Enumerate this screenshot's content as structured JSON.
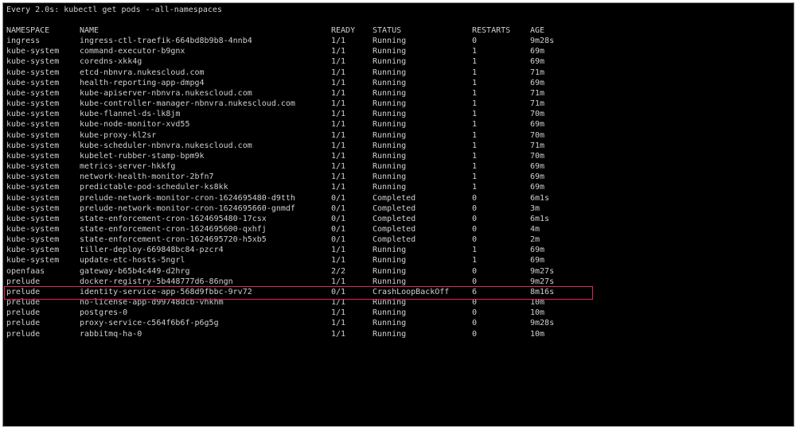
{
  "terminal": {
    "header": "Every 2.0s: kubectl get pods --all-namespaces"
  },
  "columns": {
    "namespace": "NAMESPACE",
    "name": "NAME",
    "ready": "READY",
    "status": "STATUS",
    "restarts": "RESTARTS",
    "age": "AGE"
  },
  "pods": [
    {
      "namespace": "ingress",
      "name": "ingress-ctl-traefik-664bd8b9b8-4nnb4",
      "ready": "1/1",
      "status": "Running",
      "restarts": "0",
      "age": "9m28s"
    },
    {
      "namespace": "kube-system",
      "name": "command-executor-b9gnx",
      "ready": "1/1",
      "status": "Running",
      "restarts": "1",
      "age": "69m"
    },
    {
      "namespace": "kube-system",
      "name": "coredns-xkk4g",
      "ready": "1/1",
      "status": "Running",
      "restarts": "1",
      "age": "69m"
    },
    {
      "namespace": "kube-system",
      "name": "etcd-nbnvra.nukescloud.com",
      "ready": "1/1",
      "status": "Running",
      "restarts": "1",
      "age": "71m"
    },
    {
      "namespace": "kube-system",
      "name": "health-reporting-app-dmpg4",
      "ready": "1/1",
      "status": "Running",
      "restarts": "1",
      "age": "69m"
    },
    {
      "namespace": "kube-system",
      "name": "kube-apiserver-nbnvra.nukescloud.com",
      "ready": "1/1",
      "status": "Running",
      "restarts": "1",
      "age": "71m"
    },
    {
      "namespace": "kube-system",
      "name": "kube-controller-manager-nbnvra.nukescloud.com",
      "ready": "1/1",
      "status": "Running",
      "restarts": "1",
      "age": "71m"
    },
    {
      "namespace": "kube-system",
      "name": "kube-flannel-ds-lk8jm",
      "ready": "1/1",
      "status": "Running",
      "restarts": "1",
      "age": "70m"
    },
    {
      "namespace": "kube-system",
      "name": "kube-node-monitor-xvd55",
      "ready": "1/1",
      "status": "Running",
      "restarts": "1",
      "age": "69m"
    },
    {
      "namespace": "kube-system",
      "name": "kube-proxy-kl2sr",
      "ready": "1/1",
      "status": "Running",
      "restarts": "1",
      "age": "70m"
    },
    {
      "namespace": "kube-system",
      "name": "kube-scheduler-nbnvra.nukescloud.com",
      "ready": "1/1",
      "status": "Running",
      "restarts": "1",
      "age": "71m"
    },
    {
      "namespace": "kube-system",
      "name": "kubelet-rubber-stamp-bpm9k",
      "ready": "1/1",
      "status": "Running",
      "restarts": "1",
      "age": "70m"
    },
    {
      "namespace": "kube-system",
      "name": "metrics-server-hkkfg",
      "ready": "1/1",
      "status": "Running",
      "restarts": "1",
      "age": "69m"
    },
    {
      "namespace": "kube-system",
      "name": "network-health-monitor-2bfn7",
      "ready": "1/1",
      "status": "Running",
      "restarts": "1",
      "age": "69m"
    },
    {
      "namespace": "kube-system",
      "name": "predictable-pod-scheduler-ks8kk",
      "ready": "1/1",
      "status": "Running",
      "restarts": "1",
      "age": "69m"
    },
    {
      "namespace": "kube-system",
      "name": "prelude-network-monitor-cron-1624695480-d9tth",
      "ready": "0/1",
      "status": "Completed",
      "restarts": "0",
      "age": "6m1s"
    },
    {
      "namespace": "kube-system",
      "name": "prelude-network-monitor-cron-1624695660-gnmdf",
      "ready": "0/1",
      "status": "Completed",
      "restarts": "0",
      "age": "3m"
    },
    {
      "namespace": "kube-system",
      "name": "state-enforcement-cron-1624695480-17csx",
      "ready": "0/1",
      "status": "Completed",
      "restarts": "0",
      "age": "6m1s"
    },
    {
      "namespace": "kube-system",
      "name": "state-enforcement-cron-1624695600-qxhfj",
      "ready": "0/1",
      "status": "Completed",
      "restarts": "0",
      "age": "4m"
    },
    {
      "namespace": "kube-system",
      "name": "state-enforcement-cron-1624695720-h5xb5",
      "ready": "0/1",
      "status": "Completed",
      "restarts": "0",
      "age": "2m"
    },
    {
      "namespace": "kube-system",
      "name": "tiller-deploy-669848bc84-pzcr4",
      "ready": "1/1",
      "status": "Running",
      "restarts": "1",
      "age": "69m"
    },
    {
      "namespace": "kube-system",
      "name": "update-etc-hosts-5ngrl",
      "ready": "1/1",
      "status": "Running",
      "restarts": "1",
      "age": "69m"
    },
    {
      "namespace": "openfaas",
      "name": "gateway-b65b4c449-d2hrg",
      "ready": "2/2",
      "status": "Running",
      "restarts": "0",
      "age": "9m27s"
    },
    {
      "namespace": "prelude",
      "name": "docker-registry-5b448777d6-86ngn",
      "ready": "1/1",
      "status": "Running",
      "restarts": "0",
      "age": "9m27s"
    },
    {
      "namespace": "prelude",
      "name": "identity-service-app-568d9fbbc-9rv72",
      "ready": "0/1",
      "status": "CrashLoopBackOff",
      "restarts": "6",
      "age": "8m16s"
    },
    {
      "namespace": "prelude",
      "name": "no-license-app-d99748dcb-vhkhm",
      "ready": "1/1",
      "status": "Running",
      "restarts": "0",
      "age": "10m"
    },
    {
      "namespace": "prelude",
      "name": "postgres-0",
      "ready": "1/1",
      "status": "Running",
      "restarts": "0",
      "age": "10m"
    },
    {
      "namespace": "prelude",
      "name": "proxy-service-c564f6b6f-p6g5g",
      "ready": "1/1",
      "status": "Running",
      "restarts": "0",
      "age": "9m28s"
    },
    {
      "namespace": "prelude",
      "name": "rabbitmq-ha-0",
      "ready": "1/1",
      "status": "Running",
      "restarts": "0",
      "age": "10m"
    }
  ],
  "highlight": {
    "color": "#e0245e",
    "row_index": 24
  },
  "colors": {
    "background": "#000000",
    "text": "#cfcfcf"
  }
}
